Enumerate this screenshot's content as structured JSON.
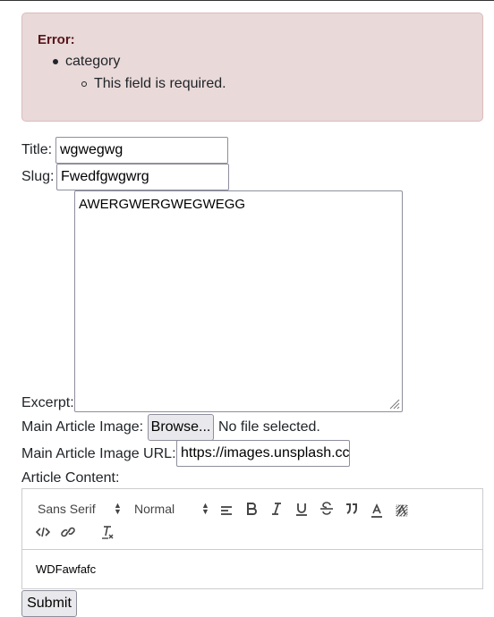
{
  "alert": {
    "title": "Error:",
    "field": "category",
    "message": "This field is required."
  },
  "form": {
    "title_label": "Title:",
    "title_value": "wgwegwg",
    "slug_label": "Slug:",
    "slug_value": "Fwedfgwgwrg",
    "excerpt_label": "Excerpt:",
    "excerpt_value": "AWERGWERGWEGWEGG",
    "image_label": "Main Article Image:",
    "browse_label": "Browse...",
    "no_file_text": "No file selected.",
    "image_url_label": "Main Article Image URL:",
    "image_url_value": "https://images.unsplash.cc",
    "content_label": "Article Content:",
    "submit_label": "Submit"
  },
  "editor": {
    "font_picker": "Sans Serif",
    "size_picker": "Normal",
    "toolbar_icons": [
      "align-icon",
      "bold-icon",
      "italic-icon",
      "underline-icon",
      "strike-icon",
      "blockquote-icon",
      "text-color-icon",
      "background-color-icon",
      "code-icon",
      "link-icon",
      "clear-format-icon"
    ],
    "content": "WDFawfafc"
  },
  "colors": {
    "alert_bg": "#e9d9d9",
    "alert_border": "#dcbcbc",
    "alert_title": "#58151c"
  }
}
